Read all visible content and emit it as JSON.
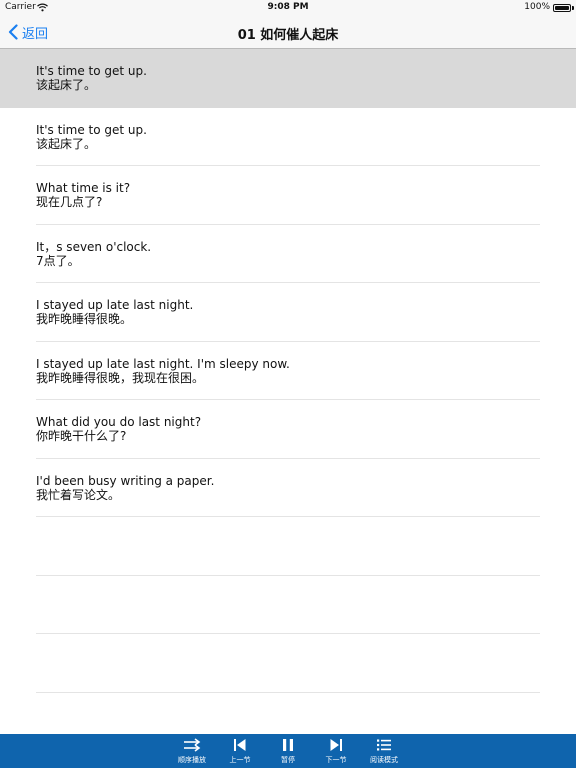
{
  "status": {
    "carrier": "Carrier",
    "time": "9:08 PM",
    "battery": "100%"
  },
  "nav": {
    "back_label": "返回",
    "title": "01 如何催人起床"
  },
  "rows": [
    {
      "en": "It's time to get up.",
      "zh": "该起床了。",
      "selected": true
    },
    {
      "en": "It's time to get up.",
      "zh": "该起床了。"
    },
    {
      "en": "What time is it?",
      "zh": "现在几点了?"
    },
    {
      "en": "It，s seven o'clock.",
      "zh": "7点了。"
    },
    {
      "en": "I stayed up late last night.",
      "zh": "我昨晚睡得很晚。"
    },
    {
      "en": "I stayed up late last night. I'm sleepy now.",
      "zh": "我昨晚睡得很晚，我现在很困。"
    },
    {
      "en": "What did you do last night?",
      "zh": "你昨晚干什么了?"
    },
    {
      "en": "I'd been busy writing a paper.",
      "zh": "我忙着写论文。"
    },
    {
      "en": "",
      "zh": ""
    },
    {
      "en": "",
      "zh": ""
    },
    {
      "en": "",
      "zh": ""
    }
  ],
  "toolbar": {
    "order_label": "顺序播放",
    "prev_label": "上一节",
    "pause_label": "暂停",
    "next_label": "下一节",
    "reading_label": "阅读模式"
  },
  "colors": {
    "accent": "#1a7ff0",
    "toolbar": "#0f64ad",
    "selected_row": "#d9d9d9"
  },
  "icons": [
    "wifi-icon",
    "battery-icon",
    "back-chevron-icon",
    "sequential-play-icon",
    "previous-icon",
    "pause-icon",
    "next-icon",
    "list-icon"
  ]
}
